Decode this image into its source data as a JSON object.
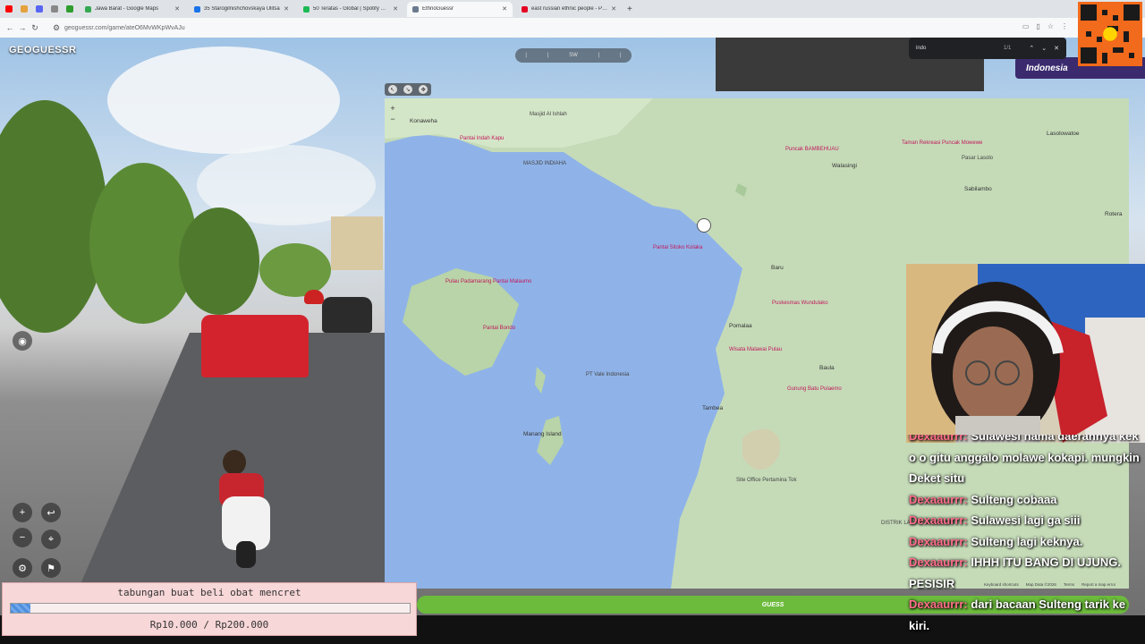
{
  "browser": {
    "tabs": [
      {
        "title": "Jawa Barat - Google Maps",
        "color": "#34a853"
      },
      {
        "title": "35 Starogilnishchovskaya Ulitsa",
        "color": "#1a73e8"
      },
      {
        "title": "50 Teratas - Global | Spotify Pl...",
        "color": "#1db954"
      },
      {
        "title": "EthnoGuessr",
        "color": "#6b7a8f"
      },
      {
        "title": "east russian ethnic people - Pi...",
        "color": "#e60023"
      }
    ],
    "active_tab_index": 3,
    "url": "geoguessr.com/game/ateO6MvWKpWvAJu"
  },
  "find_bar": {
    "query": "indo",
    "count": "1/1"
  },
  "game": {
    "logo": "GEOGUESSR",
    "compass_heading": "SW",
    "country_badge": "Indonesia",
    "guess_button": "GUESS",
    "map_footer": [
      "Keyboard shortcuts",
      "Map Data ©2026",
      "Terms",
      "Report a map error"
    ]
  },
  "map": {
    "labels": [
      {
        "text": "Konaweha",
        "kind": "town"
      },
      {
        "text": "Pantai Indah Kapu",
        "kind": "pink"
      },
      {
        "text": "Masjid Al Ishlah",
        "kind": "grey"
      },
      {
        "text": "MASJID INDIAHA",
        "kind": "grey"
      },
      {
        "text": "Puncak BAMBEHUAU",
        "kind": "pink"
      },
      {
        "text": "Taman Rekreasi Puncak Mowewe",
        "kind": "pink"
      },
      {
        "text": "Walasingi",
        "kind": "town"
      },
      {
        "text": "Pasar Lasolo",
        "kind": "grey"
      },
      {
        "text": "Lasolowatoe",
        "kind": "town"
      },
      {
        "text": "Sabilambo",
        "kind": "town"
      },
      {
        "text": "Rotera",
        "kind": "town"
      },
      {
        "text": "Baru",
        "kind": "town"
      },
      {
        "text": "Pantai Sitoko Kolaka",
        "kind": "pink"
      },
      {
        "text": "Pulau Padamarang Pantai Malaumo",
        "kind": "pink"
      },
      {
        "text": "Pantai Bondo",
        "kind": "pink"
      },
      {
        "text": "Puskesmas Wundulako",
        "kind": "pink"
      },
      {
        "text": "Pomalaa",
        "kind": "town"
      },
      {
        "text": "Wisata Malawai Pulau",
        "kind": "pink"
      },
      {
        "text": "Baula",
        "kind": "town"
      },
      {
        "text": "Gunung Batu Pulaemo",
        "kind": "pink"
      },
      {
        "text": "Tambea",
        "kind": "town"
      },
      {
        "text": "Manang Island",
        "kind": "town"
      },
      {
        "text": "PT Vale Indonesia",
        "kind": "grey"
      },
      {
        "text": "Site Office Pertamina Tok",
        "kind": "grey"
      },
      {
        "text": "DISTRIK LAOPUA BARAHIMA",
        "kind": "grey"
      }
    ]
  },
  "donation": {
    "title": "tabungan buat beli obat mencret",
    "current": "Rp10.000",
    "target": "Rp200.000",
    "progress": 0.05
  },
  "chat": [
    {
      "user": "Dexaaurrr:",
      "msg": "Sulawesi nama daerahnya kek o o gitu anggalo molawe kokapi. mungkin Deket situ"
    },
    {
      "user": "Dexaaurrr:",
      "msg": "Sulteng cobaaa"
    },
    {
      "user": "Dexaaurrr:",
      "msg": "Sulawesi lagi ga siii"
    },
    {
      "user": "Dexaaurrr:",
      "msg": "Sulteng lagi keknya."
    },
    {
      "user": "Dexaaurrr:",
      "msg": "IHHH ITU BANG DI UJUNG. PESISIR"
    },
    {
      "user": "Dexaaurrr:",
      "msg": "dari bacaan Sulteng tarik ke kiri."
    }
  ]
}
